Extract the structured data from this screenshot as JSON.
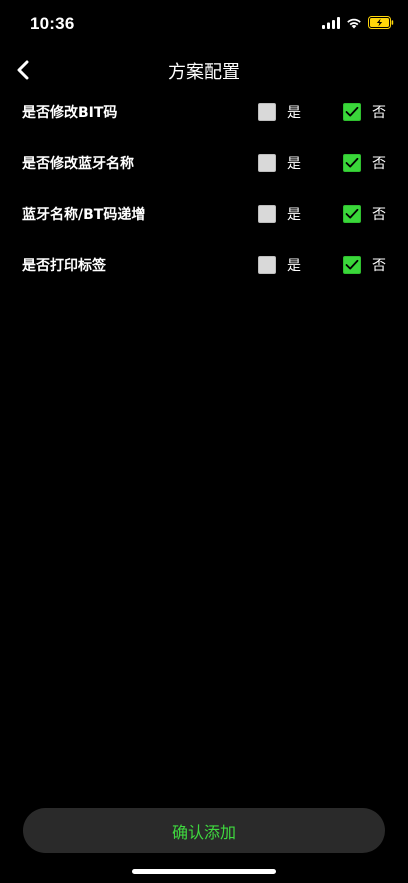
{
  "status_bar": {
    "time": "10:36",
    "battery_color": "#ffd60a"
  },
  "nav": {
    "title": "方案配置"
  },
  "settings": [
    {
      "label": "是否修改BIT码",
      "yes_label": "是",
      "no_label": "否",
      "selected": "no"
    },
    {
      "label": "是否修改蓝牙名称",
      "yes_label": "是",
      "no_label": "否",
      "selected": "no"
    },
    {
      "label": "蓝牙名称/BT码递增",
      "yes_label": "是",
      "no_label": "否",
      "selected": "no"
    },
    {
      "label": "是否打印标签",
      "yes_label": "是",
      "no_label": "否",
      "selected": "no"
    }
  ],
  "confirm_button": {
    "label": "确认添加"
  },
  "colors": {
    "checked": "#3ad73a",
    "unchecked": "#d9d9d9",
    "accent_text": "#3fd93f",
    "button_bg": "#2a2a2a"
  }
}
